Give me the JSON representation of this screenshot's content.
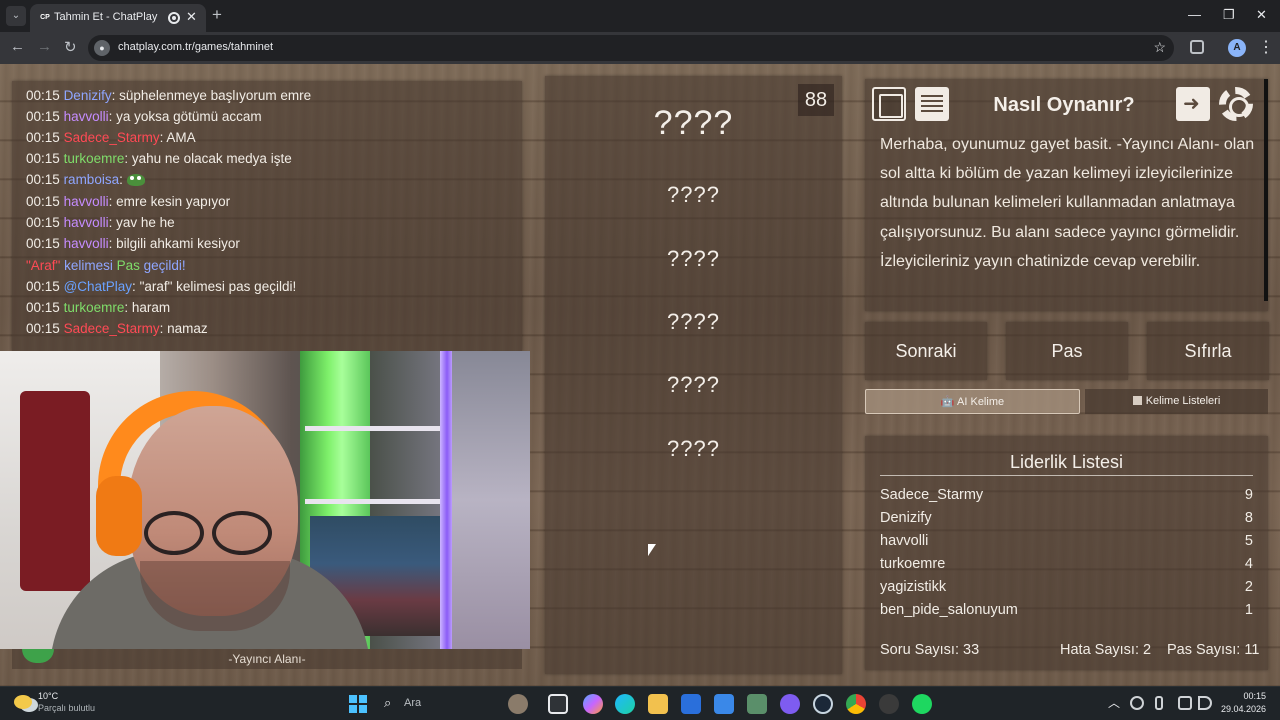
{
  "browser": {
    "tab_title": "Tahmin Et - ChatPlay",
    "tab_favicon": "CP",
    "url": "chatplay.com.tr/games/tahminet",
    "profile_initial": "A"
  },
  "chat": {
    "messages": [
      {
        "time": "00:15",
        "user": "Denizify",
        "sep": ": ",
        "text": "süphelenmeye başlıyorum emre",
        "color": "#8fa6ff"
      },
      {
        "time": "00:15",
        "user": "havvolli",
        "sep": ": ",
        "text": "ya yoksa götümü accam",
        "color": "#c58cff"
      },
      {
        "time": "00:15",
        "user": "Sadece_Starmy",
        "sep": ": ",
        "text": "AMA",
        "color": "#ff4a55"
      },
      {
        "time": "00:15",
        "user": "turkoemre",
        "sep": ": ",
        "text": "yahu ne olacak medya işte",
        "color": "#7fdd6a"
      },
      {
        "time": "00:15",
        "user": "ramboisa",
        "sep": ": ",
        "text": "",
        "emote": "pepe-emote-icon",
        "color": "#8fa6ff"
      },
      {
        "time": "00:15",
        "user": "havvolli",
        "sep": ": ",
        "text": "emre kesin yapıyor",
        "color": "#c58cff"
      },
      {
        "time": "00:15",
        "user": "havvolli",
        "sep": ": ",
        "text": "yav he he",
        "color": "#c58cff"
      },
      {
        "time": "00:15",
        "user": "havvolli",
        "sep": ": ",
        "text": "bilgili ahkami kesiyor",
        "color": "#c58cff"
      }
    ],
    "system_notice": {
      "word": "\"Araf\"",
      "middle": " kelimesi ",
      "action": "Pas",
      "end": " geçildi!"
    },
    "messages_after": [
      {
        "time": "00:15",
        "user": "@ChatPlay",
        "sep": ": ",
        "text": "\"araf\" kelimesi pas geçildi!",
        "color": "#6aa2ff"
      },
      {
        "time": "00:15",
        "user": "turkoemre",
        "sep": ": ",
        "text": "haram",
        "color": "#7fdd6a"
      },
      {
        "time": "00:15",
        "user": "Sadece_Starmy",
        "sep": ": ",
        "text": "namaz",
        "color": "#ff4a55"
      }
    ]
  },
  "streamer_area": {
    "label": "-Yayıncı Alanı-"
  },
  "game": {
    "counter": "88",
    "words": [
      "????",
      "????",
      "????",
      "????",
      "????",
      "????"
    ]
  },
  "howto": {
    "title": "Nasıl Oynanır?",
    "text": "Merhaba, oyunumuz gayet basit. -Yayıncı Alanı- olan sol altta ki bölüm de yazan kelimeyi izleyicilerinize altında bulunan kelimeleri kullanmadan anlatmaya çalışıyorsunuz. Bu alanı sadece yayıncı görmelidir. İzleyicileriniz yayın chatinizde cevap verebilir."
  },
  "controls": {
    "next": "Sonraki",
    "pass": "Pas",
    "reset": "Sıfırla",
    "ai_word": "AI Kelime",
    "word_lists": "Kelime Listeleri"
  },
  "leaderboard": {
    "title": "Liderlik Listesi",
    "rows": [
      {
        "name": "Sadece_Starmy",
        "score": "9"
      },
      {
        "name": "Denizify",
        "score": "8"
      },
      {
        "name": "havvolli",
        "score": "5"
      },
      {
        "name": "turkoemre",
        "score": "4"
      },
      {
        "name": "yagizistikk",
        "score": "2"
      },
      {
        "name": "ben_pide_salonuyum",
        "score": "1"
      }
    ],
    "question_count": "Soru Sayısı: 33",
    "error_count": "Hata Sayısı: 2",
    "pass_count": "Pas Sayısı: 11"
  },
  "taskbar": {
    "temperature": "10°C",
    "weather": "Parçalı bulutlu",
    "search_placeholder": "Ara",
    "time": "00:15",
    "date": "29.04.2026"
  }
}
